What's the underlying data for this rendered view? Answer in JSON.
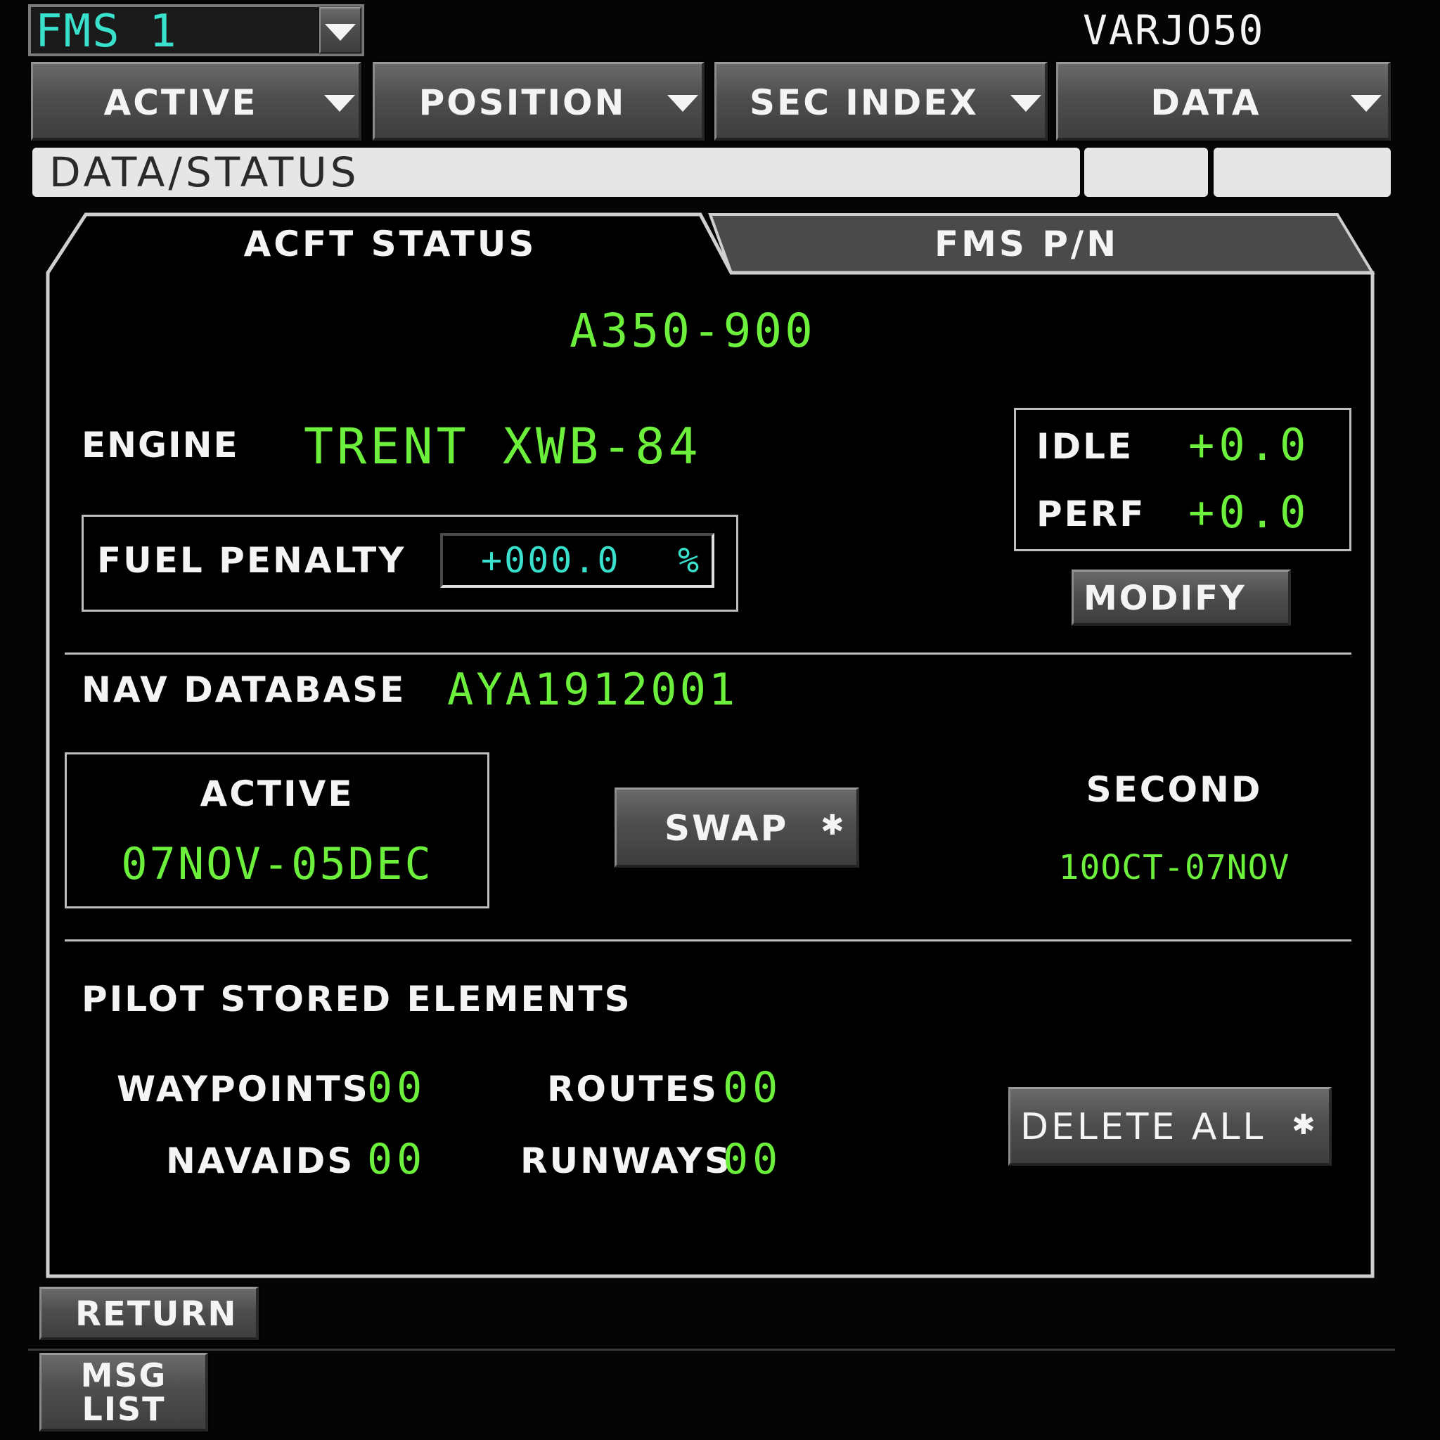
{
  "header": {
    "fms_selector": "FMS 1",
    "flight_id": "VARJO50"
  },
  "menu": [
    {
      "label": "ACTIVE"
    },
    {
      "label": "POSITION"
    },
    {
      "label": "SEC INDEX"
    },
    {
      "label": "DATA"
    }
  ],
  "title_bar": {
    "title": "DATA/STATUS"
  },
  "tabs": {
    "active": "ACFT STATUS",
    "inactive": "FMS P/N"
  },
  "aircraft": {
    "type": "A350-900",
    "engine_label": "ENGINE",
    "engine_value": "TRENT XWB-84",
    "fuel_penalty_label": "FUEL PENALTY",
    "fuel_penalty_value": "+000.0",
    "fuel_penalty_unit": "%",
    "idle_label": "IDLE",
    "idle_value": "+0.0",
    "perf_label": "PERF",
    "perf_value": "+0.0",
    "modify_label": "MODIFY"
  },
  "nav_database": {
    "label": "NAV DATABASE",
    "value": "AYA1912001",
    "active_label": "ACTIVE",
    "active_range": "07NOV-05DEC",
    "swap_label": "SWAP",
    "swap_star": "✱",
    "second_label": "SECOND",
    "second_range": "10OCT-07NOV"
  },
  "pilot_stored": {
    "title": "PILOT STORED ELEMENTS",
    "waypoints_label": "WAYPOINTS",
    "waypoints_value": "00",
    "routes_label": "ROUTES",
    "routes_value": "00",
    "navaids_label": "NAVAIDS",
    "navaids_value": "00",
    "runways_label": "RUNWAYS",
    "runways_value": "00",
    "delete_label": "DELETE ALL",
    "delete_star": "✱"
  },
  "footer": {
    "return_label": "RETURN",
    "msg_line1": "MSG",
    "msg_line2": "LIST"
  },
  "colors": {
    "green": "#6cf03c",
    "cyan": "#39e0cc",
    "white": "#f4f4f4",
    "background": "#050505",
    "button_gray": "#555555"
  }
}
